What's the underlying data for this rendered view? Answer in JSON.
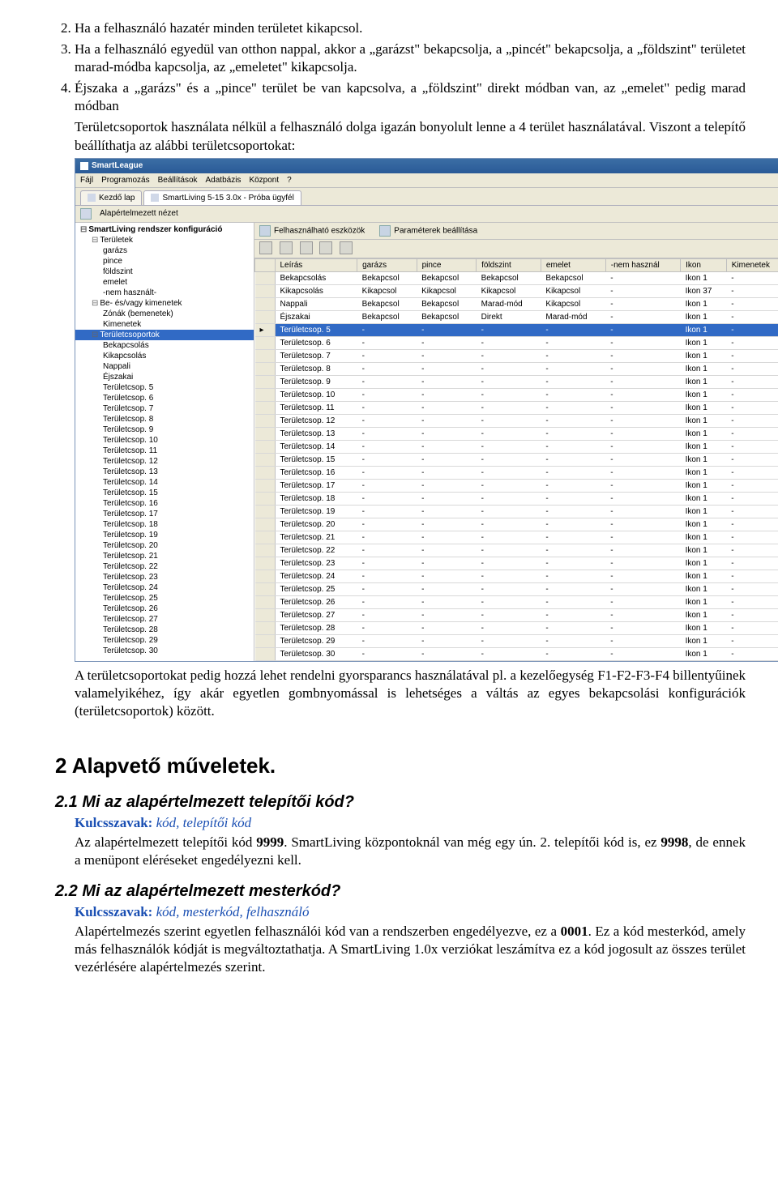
{
  "list": {
    "item2": "Ha a felhasználó hazatér minden területet kikapcsol.",
    "item3": "Ha a felhasználó egyedül van otthon nappal, akkor a „garázst\" bekapcsolja, a „pincét\" bekapcsolja, a „földszint\" területet marad-módba kapcsolja, az „emeletet\" kikapcsolja.",
    "item4": "Éjszaka a „garázs\" és a „pince\" terület be van kapcsolva, a „földszint\" direkt módban van, az „emelet\" pedig marad módban"
  },
  "para_before_shot": "Területcsoportok használata nélkül a felhasználó dolga igazán bonyolult lenne a 4 terület használatával. Viszont a telepítő beállíthatja az alábbi területcsoportokat:",
  "app": {
    "title": "SmartLeague",
    "menu": [
      "Fájl",
      "Programozás",
      "Beállítások",
      "Adatbázis",
      "Központ",
      "?"
    ],
    "tabs": [
      {
        "label": "Kezdő lap",
        "active": false
      },
      {
        "label": "SmartLiving 5-15 3.0x - Próba ügyfél",
        "active": true
      }
    ],
    "sub1": "Alapértelmezett nézet",
    "tool_tabs": [
      {
        "label": "Felhasználható eszközök"
      },
      {
        "label": "Paraméterek beállítása"
      }
    ],
    "tree": [
      {
        "d": 0,
        "t": "SmartLiving rendszer konfiguráció",
        "exp": "⊟"
      },
      {
        "d": 1,
        "t": "Területek",
        "exp": "⊟"
      },
      {
        "d": 2,
        "t": "garázs"
      },
      {
        "d": 2,
        "t": "pince"
      },
      {
        "d": 2,
        "t": "földszint"
      },
      {
        "d": 2,
        "t": "emelet"
      },
      {
        "d": 2,
        "t": "-nem használt-"
      },
      {
        "d": 1,
        "t": "Be- és/vagy kimenetek",
        "exp": "⊟"
      },
      {
        "d": 2,
        "t": "Zónák (bemenetek)"
      },
      {
        "d": 2,
        "t": "Kimenetek"
      },
      {
        "d": 1,
        "t": "Területcsoportok",
        "sel": true,
        "exp": "⊟"
      },
      {
        "d": 2,
        "t": "Bekapcsolás"
      },
      {
        "d": 2,
        "t": "Kikapcsolás"
      },
      {
        "d": 2,
        "t": "Nappali"
      },
      {
        "d": 2,
        "t": "Éjszakai"
      },
      {
        "d": 2,
        "t": "Területcsop. 5"
      },
      {
        "d": 2,
        "t": "Területcsop. 6"
      },
      {
        "d": 2,
        "t": "Területcsop. 7"
      },
      {
        "d": 2,
        "t": "Területcsop. 8"
      },
      {
        "d": 2,
        "t": "Területcsop. 9"
      },
      {
        "d": 2,
        "t": "Területcsop. 10"
      },
      {
        "d": 2,
        "t": "Területcsop. 11"
      },
      {
        "d": 2,
        "t": "Területcsop. 12"
      },
      {
        "d": 2,
        "t": "Területcsop. 13"
      },
      {
        "d": 2,
        "t": "Területcsop. 14"
      },
      {
        "d": 2,
        "t": "Területcsop. 15"
      },
      {
        "d": 2,
        "t": "Területcsop. 16"
      },
      {
        "d": 2,
        "t": "Területcsop. 17"
      },
      {
        "d": 2,
        "t": "Területcsop. 18"
      },
      {
        "d": 2,
        "t": "Területcsop. 19"
      },
      {
        "d": 2,
        "t": "Területcsop. 20"
      },
      {
        "d": 2,
        "t": "Területcsop. 21"
      },
      {
        "d": 2,
        "t": "Területcsop. 22"
      },
      {
        "d": 2,
        "t": "Területcsop. 23"
      },
      {
        "d": 2,
        "t": "Területcsop. 24"
      },
      {
        "d": 2,
        "t": "Területcsop. 25"
      },
      {
        "d": 2,
        "t": "Területcsop. 26"
      },
      {
        "d": 2,
        "t": "Területcsop. 27"
      },
      {
        "d": 2,
        "t": "Területcsop. 28"
      },
      {
        "d": 2,
        "t": "Területcsop. 29"
      },
      {
        "d": 2,
        "t": "Területcsop. 30"
      }
    ],
    "grid": {
      "headers": [
        "Leírás",
        "garázs",
        "pince",
        "földszint",
        "emelet",
        "-nem használ",
        "Ikon",
        "Kimenetek"
      ],
      "rows": [
        {
          "c": [
            "Bekapcsolás",
            "Bekapcsol",
            "Bekapcsol",
            "Bekapcsol",
            "Bekapcsol",
            "-",
            "Ikon 1",
            "-"
          ]
        },
        {
          "c": [
            "Kikapcsolás",
            "Kikapcsol",
            "Kikapcsol",
            "Kikapcsol",
            "Kikapcsol",
            "-",
            "Ikon 37",
            "-"
          ]
        },
        {
          "c": [
            "Nappali",
            "Bekapcsol",
            "Bekapcsol",
            "Marad-mód",
            "Kikapcsol",
            "-",
            "Ikon 1",
            "-"
          ]
        },
        {
          "c": [
            "Éjszakai",
            "Bekapcsol",
            "Bekapcsol",
            "Direkt",
            "Marad-mód",
            "-",
            "Ikon 1",
            "-"
          ]
        },
        {
          "c": [
            "Területcsop. 5",
            "-",
            "-",
            "-",
            "-",
            "-",
            "Ikon 1",
            "-"
          ],
          "sel": true
        },
        {
          "c": [
            "Területcsop. 6",
            "-",
            "-",
            "-",
            "-",
            "-",
            "Ikon 1",
            "-"
          ]
        },
        {
          "c": [
            "Területcsop. 7",
            "-",
            "-",
            "-",
            "-",
            "-",
            "Ikon 1",
            "-"
          ]
        },
        {
          "c": [
            "Területcsop. 8",
            "-",
            "-",
            "-",
            "-",
            "-",
            "Ikon 1",
            "-"
          ]
        },
        {
          "c": [
            "Területcsop. 9",
            "-",
            "-",
            "-",
            "-",
            "-",
            "Ikon 1",
            "-"
          ]
        },
        {
          "c": [
            "Területcsop. 10",
            "-",
            "-",
            "-",
            "-",
            "-",
            "Ikon 1",
            "-"
          ]
        },
        {
          "c": [
            "Területcsop. 11",
            "-",
            "-",
            "-",
            "-",
            "-",
            "Ikon 1",
            "-"
          ]
        },
        {
          "c": [
            "Területcsop. 12",
            "-",
            "-",
            "-",
            "-",
            "-",
            "Ikon 1",
            "-"
          ]
        },
        {
          "c": [
            "Területcsop. 13",
            "-",
            "-",
            "-",
            "-",
            "-",
            "Ikon 1",
            "-"
          ]
        },
        {
          "c": [
            "Területcsop. 14",
            "-",
            "-",
            "-",
            "-",
            "-",
            "Ikon 1",
            "-"
          ]
        },
        {
          "c": [
            "Területcsop. 15",
            "-",
            "-",
            "-",
            "-",
            "-",
            "Ikon 1",
            "-"
          ]
        },
        {
          "c": [
            "Területcsop. 16",
            "-",
            "-",
            "-",
            "-",
            "-",
            "Ikon 1",
            "-"
          ]
        },
        {
          "c": [
            "Területcsop. 17",
            "-",
            "-",
            "-",
            "-",
            "-",
            "Ikon 1",
            "-"
          ]
        },
        {
          "c": [
            "Területcsop. 18",
            "-",
            "-",
            "-",
            "-",
            "-",
            "Ikon 1",
            "-"
          ]
        },
        {
          "c": [
            "Területcsop. 19",
            "-",
            "-",
            "-",
            "-",
            "-",
            "Ikon 1",
            "-"
          ]
        },
        {
          "c": [
            "Területcsop. 20",
            "-",
            "-",
            "-",
            "-",
            "-",
            "Ikon 1",
            "-"
          ]
        },
        {
          "c": [
            "Területcsop. 21",
            "-",
            "-",
            "-",
            "-",
            "-",
            "Ikon 1",
            "-"
          ]
        },
        {
          "c": [
            "Területcsop. 22",
            "-",
            "-",
            "-",
            "-",
            "-",
            "Ikon 1",
            "-"
          ]
        },
        {
          "c": [
            "Területcsop. 23",
            "-",
            "-",
            "-",
            "-",
            "-",
            "Ikon 1",
            "-"
          ]
        },
        {
          "c": [
            "Területcsop. 24",
            "-",
            "-",
            "-",
            "-",
            "-",
            "Ikon 1",
            "-"
          ]
        },
        {
          "c": [
            "Területcsop. 25",
            "-",
            "-",
            "-",
            "-",
            "-",
            "Ikon 1",
            "-"
          ]
        },
        {
          "c": [
            "Területcsop. 26",
            "-",
            "-",
            "-",
            "-",
            "-",
            "Ikon 1",
            "-"
          ]
        },
        {
          "c": [
            "Területcsop. 27",
            "-",
            "-",
            "-",
            "-",
            "-",
            "Ikon 1",
            "-"
          ]
        },
        {
          "c": [
            "Területcsop. 28",
            "-",
            "-",
            "-",
            "-",
            "-",
            "Ikon 1",
            "-"
          ]
        },
        {
          "c": [
            "Területcsop. 29",
            "-",
            "-",
            "-",
            "-",
            "-",
            "Ikon 1",
            "-"
          ]
        },
        {
          "c": [
            "Területcsop. 30",
            "-",
            "-",
            "-",
            "-",
            "-",
            "Ikon 1",
            "-"
          ]
        }
      ]
    }
  },
  "para_after_shot": "A területcsoportokat pedig hozzá lehet rendelni gyorsparancs használatával pl. a kezelőegység F1-F2-F3-F4 billentyűinek valamelyikéhez, így akár egyetlen gombnyomással is lehetséges a váltás az egyes bekapcsolási konfigurációk (területcsoportok) között.",
  "h2": "2  Alapvető műveletek.",
  "s21": {
    "h": "2.1  Mi az alapértelmezett telepítői kód?",
    "kw_label": "Kulcsszavak:",
    "kw": " kód, telepítői kód",
    "body_a": "Az alapértelmezett telepítői kód ",
    "code1": "9999",
    "body_b": ". SmartLiving központoknál van még egy ún. 2. telepítői kód is, ez ",
    "code2": "9998",
    "body_c": ", de ennek a menüpont eléréseket engedélyezni kell."
  },
  "s22": {
    "h": "2.2  Mi az alapértelmezett mesterkód?",
    "kw_label": "Kulcsszavak:",
    "kw": " kód, mesterkód, felhasználó",
    "body_a": "Alapértelmezés szerint egyetlen felhasználói kód van a rendszerben engedélyezve, ez a ",
    "code": "0001",
    "body_b": ". Ez a kód mesterkód, amely más felhasználók kódját is megváltoztathatja. A SmartLiving 1.0x verziókat leszámítva ez a kód jogosult az összes terület vezérlésére alapértelmezés szerint."
  }
}
